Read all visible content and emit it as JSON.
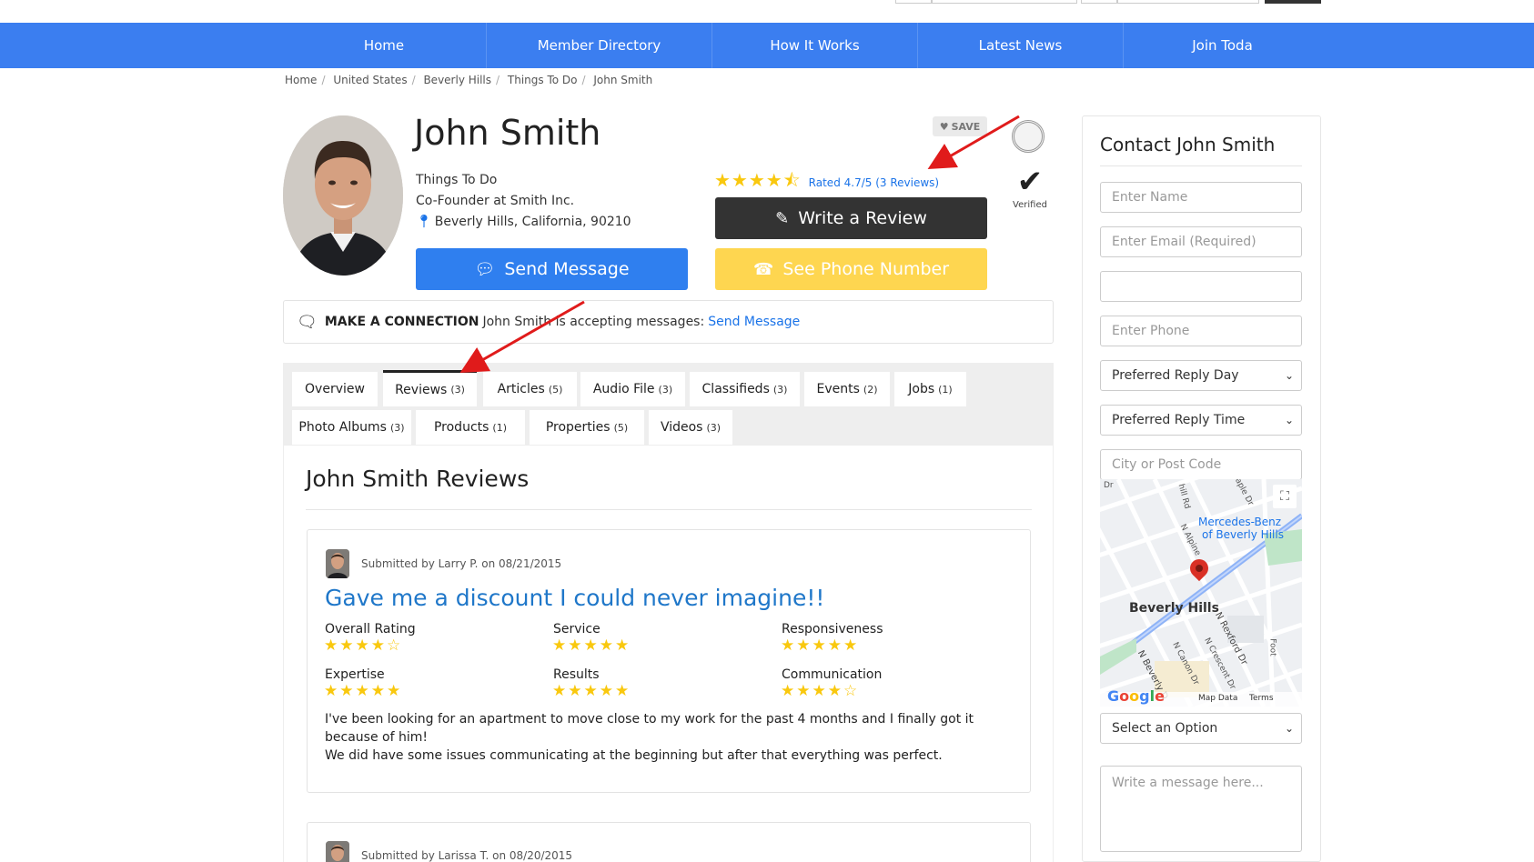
{
  "nav": {
    "items": [
      {
        "label": "Home"
      },
      {
        "label": "Member Directory"
      },
      {
        "label": "How It Works"
      },
      {
        "label": "Latest News"
      },
      {
        "label": "Join Toda"
      }
    ]
  },
  "breadcrumb": [
    "Home",
    "United States",
    "Beverly Hills",
    "Things To Do",
    "John Smith"
  ],
  "profile": {
    "name": "John Smith",
    "category": "Things To Do",
    "position": "Co-Founder at Smith Inc.",
    "location": "Beverly Hills, California, 90210",
    "save_label": "SAVE",
    "rating_text": "Rated 4.7/5 (3 Reviews)",
    "stars": "★★★★⯪",
    "write_review_label": "Write a Review",
    "send_message_label": "Send Message",
    "see_phone_label": "See Phone Number",
    "verified_label": "Verified"
  },
  "connection": {
    "lead": "MAKE A CONNECTION",
    "text": "John Smith is accepting messages:",
    "link": "Send Message"
  },
  "tabs": [
    {
      "label": "Overview",
      "count": ""
    },
    {
      "label": "Reviews",
      "count": "(3)"
    },
    {
      "label": "Articles",
      "count": "(5)"
    },
    {
      "label": "Audio File",
      "count": "(3)"
    },
    {
      "label": "Classifieds",
      "count": "(3)"
    },
    {
      "label": "Events",
      "count": "(2)"
    },
    {
      "label": "Jobs",
      "count": "(1)"
    },
    {
      "label": "Photo Albums",
      "count": "(3)"
    },
    {
      "label": "Products",
      "count": "(1)"
    },
    {
      "label": "Properties",
      "count": "(5)"
    },
    {
      "label": "Videos",
      "count": "(3)"
    }
  ],
  "reviews": {
    "title": "John Smith Reviews",
    "items": [
      {
        "submitted": "Submitted by Larry P. on 08/21/2015",
        "title": "Gave me a discount I could never imagine!!",
        "criteria": [
          {
            "label": "Overall Rating",
            "stars": "★★★★☆"
          },
          {
            "label": "Service",
            "stars": "★★★★★"
          },
          {
            "label": "Responsiveness",
            "stars": "★★★★★"
          },
          {
            "label": "Expertise",
            "stars": "★★★★★"
          },
          {
            "label": "Results",
            "stars": "★★★★★"
          },
          {
            "label": "Communication",
            "stars": "★★★★☆"
          }
        ],
        "body_line1": "I've been looking for an apartment to move close to my work for the past 4 months and I finally got it because of him!",
        "body_line2": "We did have some issues communicating at the beginning but after that everything was perfect."
      },
      {
        "submitted": "Submitted by Larissa T. on 08/20/2015"
      }
    ]
  },
  "contact": {
    "title": "Contact John Smith",
    "name_placeholder": "Enter Name",
    "email_placeholder": "Enter Email (Required)",
    "phone_placeholder": "Enter Phone",
    "reply_day": "Preferred Reply Day",
    "reply_time": "Preferred Reply Time",
    "city_placeholder": "City or Post Code",
    "option": "Select an Option",
    "message_placeholder": "Write a message here..."
  },
  "map": {
    "labels": [
      "Mercedes-Benz",
      "of Beverly Hills",
      "Beverly Hills",
      "N Alpine",
      "N Rexford Dr",
      "N Canon Dr",
      "N Crescent Dr",
      "N Beverly D",
      "hill Rd",
      "laple Dr",
      "Foot",
      "Dr"
    ],
    "attribution": [
      "Map Data",
      "Terms"
    ],
    "google": "Google"
  },
  "colors": {
    "nav": "#3b7ef0",
    "send_button": "#2f7fef",
    "review_button": "#333333",
    "phone_button": "#fed650",
    "star": "#f9c80e",
    "link": "#1a73e8",
    "review_title": "#1f77c9"
  }
}
